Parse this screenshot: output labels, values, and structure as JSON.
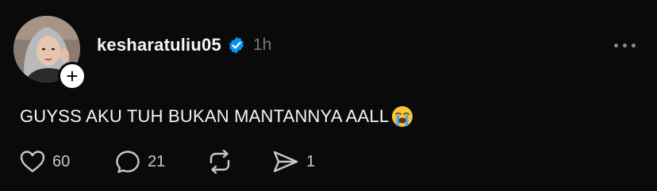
{
  "post": {
    "username": "kesharatuliu05",
    "time": "1h",
    "text": "GUYSS AKU TUH BUKAN MANTANNYA AALL",
    "emoji": "loudly-crying-face",
    "verified": true,
    "follow_symbol": "+"
  },
  "actions": {
    "like_count": "60",
    "reply_count": "21",
    "share_count": "1"
  },
  "colors": {
    "background": "#0a0a0a",
    "text": "#f3f5f7",
    "muted": "#777777",
    "verified_blue": "#0095f6"
  }
}
